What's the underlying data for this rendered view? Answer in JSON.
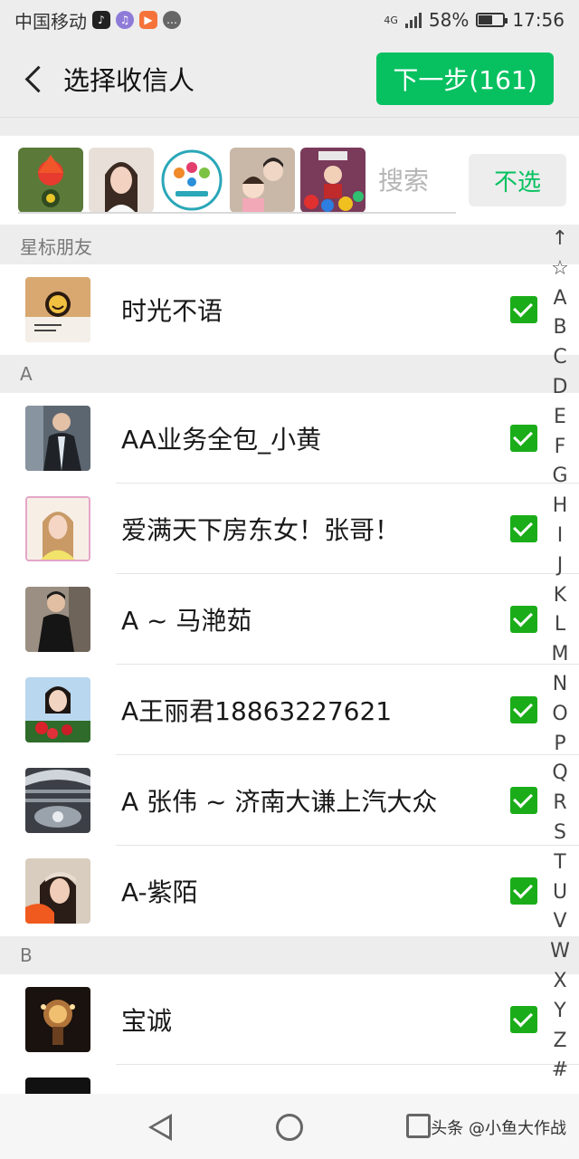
{
  "status": {
    "carrier": "中国移动",
    "network": "4G",
    "battery": "58%",
    "battery_level": 0.58,
    "time": "17:56"
  },
  "header": {
    "title": "选择收信人",
    "next_label": "下一步(161)"
  },
  "selected": {
    "search_placeholder": "搜索",
    "deselect_label": "不选"
  },
  "sections": [
    {
      "title": "星标朋友",
      "contacts": [
        "时光不语"
      ]
    },
    {
      "title": "A",
      "contacts": [
        "AA业务全包_小黄",
        "爱满天下房东女！张哥！",
        "A ~ 马滟茹",
        "A王丽君18863227621",
        "A 张伟 ~ 济南大谦上汽大众",
        "A-紫陌"
      ]
    },
    {
      "title": "B",
      "contacts": [
        "宝诚",
        ""
      ]
    }
  ],
  "index": [
    "↑",
    "☆",
    "A",
    "B",
    "C",
    "D",
    "E",
    "F",
    "G",
    "H",
    "I",
    "J",
    "K",
    "L",
    "M",
    "N",
    "O",
    "P",
    "Q",
    "R",
    "S",
    "T",
    "U",
    "V",
    "W",
    "X",
    "Y",
    "Z",
    "#"
  ],
  "watermark": "头条 @小鱼大作战",
  "colors": {
    "accent": "#07c160",
    "check": "#1aad19",
    "background": "#ededed"
  },
  "icons": [
    "tiktok-icon",
    "music-icon",
    "video-icon",
    "chat-icon",
    "signal-icon",
    "battery-icon",
    "back-icon",
    "checkbox-checked-icon",
    "nav-back-icon",
    "nav-home-icon",
    "nav-recent-icon"
  ]
}
